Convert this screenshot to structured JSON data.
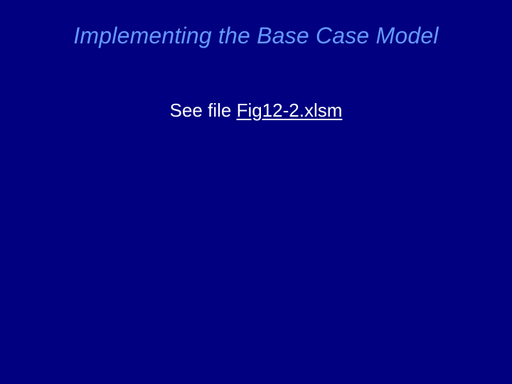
{
  "slide": {
    "title": "Implementing the Base Case Model",
    "prefix_text": "See file ",
    "link_text": "Fig12-2.xlsm"
  }
}
